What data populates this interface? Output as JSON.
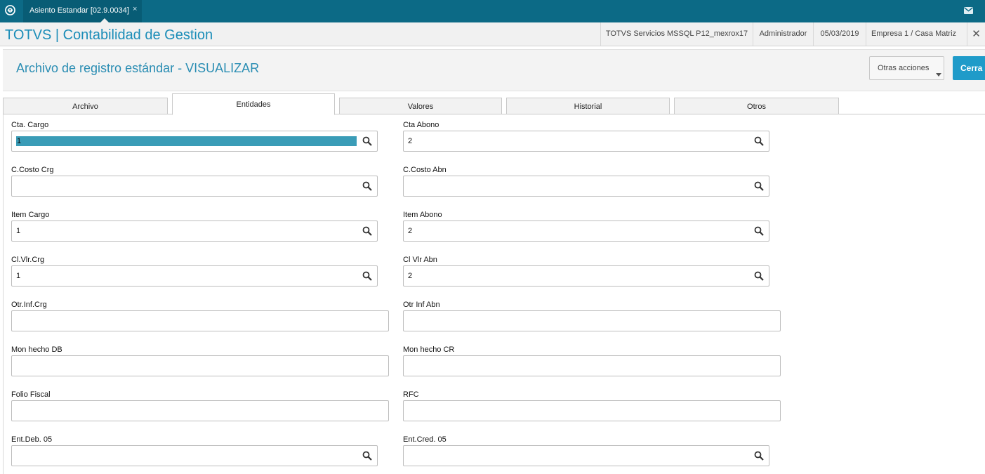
{
  "topbar": {
    "tab_label": "Asiento Estandar [02.9.0034]",
    "tab_close": "×",
    "mail_icon": "mail-icon"
  },
  "header": {
    "app_title": "TOTVS | Contabilidad de Gestion",
    "server": "TOTVS Servicios MSSQL P12_mexrox17",
    "user": "Administrador",
    "date": "05/03/2019",
    "company": "Empresa 1 / Casa Matriz",
    "close": "✕"
  },
  "page": {
    "title": "Archivo de registro estándar - VISUALIZAR",
    "other_actions": "Otras acciones",
    "close_button": "Cerra"
  },
  "tabs": [
    {
      "label": "Archivo",
      "active": false
    },
    {
      "label": "Entidades",
      "active": true
    },
    {
      "label": "Valores",
      "active": false
    },
    {
      "label": "Historial",
      "active": false
    },
    {
      "label": "Otros",
      "active": false
    }
  ],
  "form": {
    "cta_cargo": {
      "label": "Cta. Cargo",
      "value": "1"
    },
    "cta_abono": {
      "label": "Cta Abono",
      "value": "2"
    },
    "ccosto_crg": {
      "label": "C.Costo Crg",
      "value": ""
    },
    "ccosto_abn": {
      "label": "C.Costo Abn",
      "value": ""
    },
    "item_cargo": {
      "label": "Item Cargo",
      "value": "1"
    },
    "item_abono": {
      "label": "Item Abono",
      "value": "2"
    },
    "cl_vlr_crg": {
      "label": "Cl.Vlr.Crg",
      "value": "1"
    },
    "cl_vlr_abn": {
      "label": "Cl Vlr Abn",
      "value": "2"
    },
    "otr_inf_crg": {
      "label": "Otr.Inf.Crg",
      "value": ""
    },
    "otr_inf_abn": {
      "label": "Otr Inf Abn",
      "value": ""
    },
    "mon_hecho_db": {
      "label": "Mon hecho DB",
      "value": ""
    },
    "mon_hecho_cr": {
      "label": "Mon hecho CR",
      "value": ""
    },
    "folio_fiscal": {
      "label": "Folio Fiscal",
      "value": ""
    },
    "rfc": {
      "label": "RFC",
      "value": ""
    },
    "ent_deb_05": {
      "label": "Ent.Deb. 05",
      "value": ""
    },
    "ent_cred_05": {
      "label": "Ent.Cred. 05",
      "value": ""
    }
  }
}
